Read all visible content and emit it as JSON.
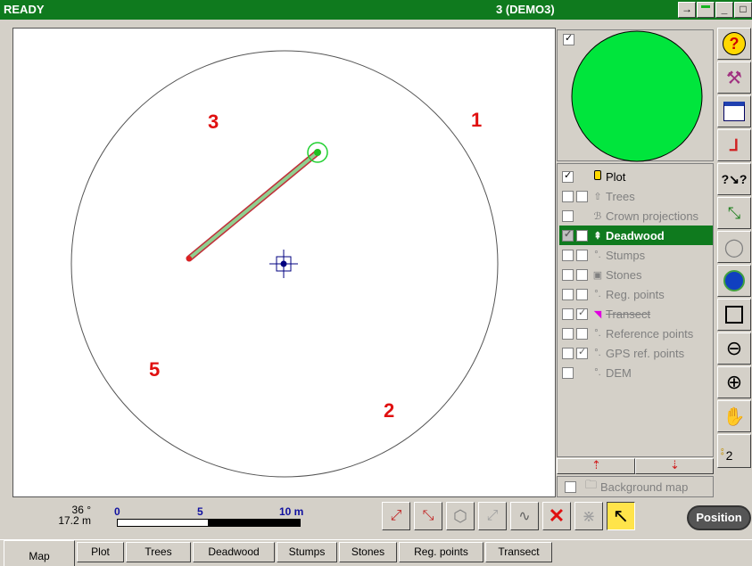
{
  "titlebar": {
    "status": "READY",
    "project": "3 (DEMO3)"
  },
  "map": {
    "sector_labels": [
      "3",
      "1",
      "5",
      "2"
    ]
  },
  "minimap": {
    "checked": true
  },
  "layers": [
    {
      "label": "Plot",
      "checked": true,
      "state": "plain"
    },
    {
      "label": "Trees",
      "checked": false,
      "state": "disabled"
    },
    {
      "label": "Crown projections",
      "checked": false,
      "state": "disabled"
    },
    {
      "label": "Deadwood",
      "checked": true,
      "state": "active"
    },
    {
      "label": "Stumps",
      "checked": false,
      "state": "disabled"
    },
    {
      "label": "Stones",
      "checked": false,
      "state": "disabled"
    },
    {
      "label": "Reg. points",
      "checked": false,
      "state": "disabled"
    },
    {
      "label": "Transect",
      "checked": false,
      "state": "disabled"
    },
    {
      "label": "Reference points",
      "checked": false,
      "state": "disabled"
    },
    {
      "label": "GPS ref. points",
      "checked": false,
      "state": "disabled"
    },
    {
      "label": "DEM",
      "checked": false,
      "state": "disabled"
    }
  ],
  "background_map": {
    "label": "Background map",
    "checked": false
  },
  "bottom": {
    "angle": "36 °",
    "distance": "17.2 m",
    "scale": {
      "start": "0",
      "mid": "5",
      "end": "10 m"
    },
    "position_button": "Position"
  },
  "side_toolbar": {
    "counter": "2"
  },
  "tabs": [
    "Map",
    "Plot",
    "Trees",
    "Deadwood",
    "Stumps",
    "Stones",
    "Reg. points",
    "Transect"
  ],
  "colors": {
    "titlebar": "#0f7a1e",
    "minimap_fill": "#00e53c",
    "sector_label": "#e01010"
  }
}
